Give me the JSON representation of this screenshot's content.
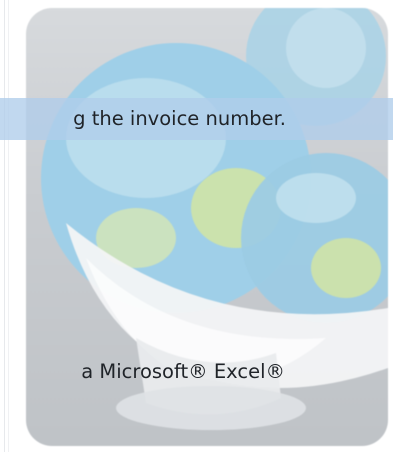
{
  "help_text": {
    "instruction_fragment": "g the invoice number.",
    "excel_fragment": "a Microsoft® Excel®"
  },
  "artwork": {
    "icon": "globe-in-bowl-icon",
    "colors": {
      "globe_blue": "#9fcfe8",
      "globe_green": "#cfe3a6",
      "bowl_white": "#f3f4f5",
      "backdrop_gray": "#c9ccd0"
    }
  },
  "colors": {
    "highlight": "#b0cdeb",
    "text": "#1f2328"
  }
}
